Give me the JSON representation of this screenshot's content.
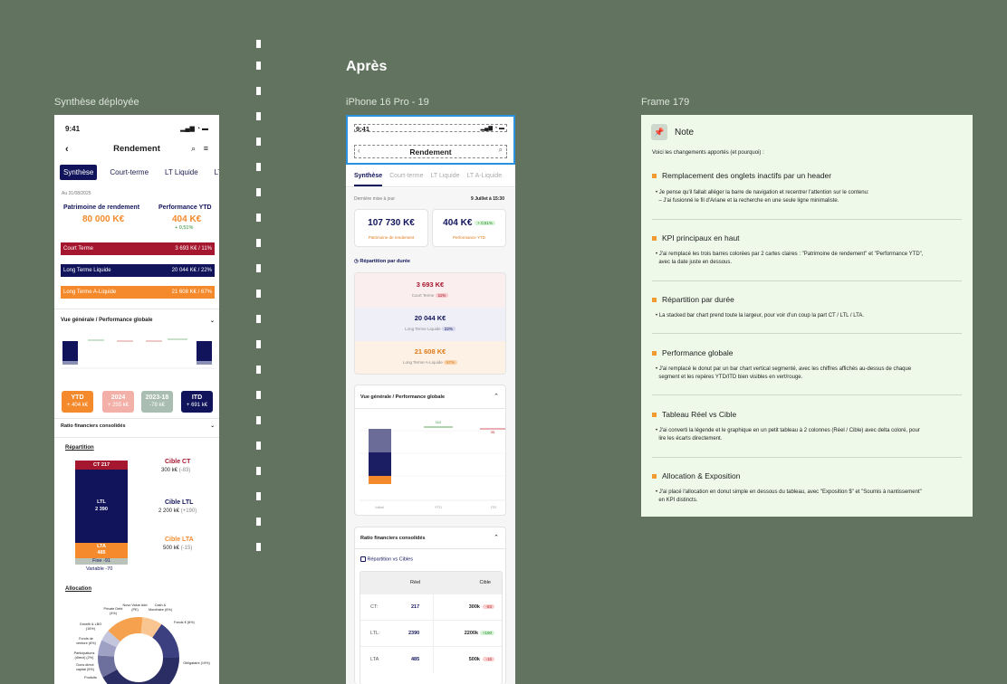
{
  "labels": {
    "left_frame": "Synthèse déployée",
    "after": "Après",
    "mid_frame": "iPhone 16 Pro - 19",
    "right_frame": "Frame 179"
  },
  "phone1": {
    "time": "9:41",
    "title": "Rendement",
    "tabs": [
      "Synthèse",
      "Court-terme",
      "LT Liquide",
      "LT"
    ],
    "date": "Au 31/08/2025",
    "kpi_left_label": "Patrimoine de rendement",
    "kpi_left_value": "80 000 K€",
    "kpi_right_label": "Performance YTD",
    "kpi_right_value": "404 K€",
    "kpi_right_delta": "+ 0,51%",
    "bars": [
      {
        "label": "Court Terme",
        "value": "3 693 K€  /  11%",
        "color": "#a5162f"
      },
      {
        "label": "Long Terme Liquide",
        "value": "20 044 K€  /  22%",
        "color": "#11145a"
      },
      {
        "label": "Long Terme A-Liquide",
        "value": "21 608 K€  /  67%",
        "color": "#f58a2c"
      }
    ],
    "section_overview": "Vue générale / Performance globale",
    "pills": [
      {
        "title": "YTD",
        "value": "+ 404 k€",
        "color": "#f58a2c"
      },
      {
        "title": "2024",
        "value": "+ 255 k€",
        "color": "#f3b0a8"
      },
      {
        "title": "2023-18",
        "value": "-78 k€",
        "color": "#a9bdb2"
      },
      {
        "title": "ITD",
        "value": "+ 691 k€",
        "color": "#11145a"
      }
    ],
    "section_ratios": "Ratio financiers consolidés",
    "repartition_title": "Répartition",
    "stack": {
      "ct": "CT 217",
      "ltl": "LTL",
      "ltl_val": "2 390",
      "lta": "LTA",
      "lta_val": "485",
      "fixe": "Fixe -91",
      "variable": "Variable -70"
    },
    "targets": [
      {
        "title": "Cible CT",
        "value": "300 k€",
        "delta": "(-83)",
        "color": "#a5162f"
      },
      {
        "title": "Cible LTL",
        "value": "2 200 k€",
        "delta": "(+190)",
        "color": "#11145a"
      },
      {
        "title": "Cible LTA",
        "value": "500 k€",
        "delta": "(-15)",
        "color": "#f58a2c"
      }
    ],
    "allocation_title": "Allocation",
    "donut_labels": {
      "a": "Private Debt (4%)",
      "b": "Novo Value Add (PE)",
      "c": "Cash & Monétaire (6%)",
      "d": "Fonds € (6%)",
      "e": "Growth & LBO (16%)",
      "f": "Fonds de venture (6%)",
      "g": "Participations (direct) (2%)",
      "h": "Dons direct capital (5%)",
      "i": "Obligataire (19%)",
      "j": "Produits"
    }
  },
  "phone2": {
    "time": "9:41",
    "title": "Rendement",
    "tabs": [
      "Synthèse",
      "Court-terme",
      "LT Liquide",
      "LT A-Liquide"
    ],
    "updated_label": "Dernière mise à jour",
    "updated_value": "9 Juillet à 15:30",
    "kpi1_value": "107 730 K€",
    "kpi1_label": "Patrimoine de rendement",
    "kpi2_value": "404 K€",
    "kpi2_tag": "+ 0,51%",
    "kpi2_label": "Performance YTD",
    "duration_title": "Répartition par durée",
    "durations": [
      {
        "value": "3 693 K€",
        "label": "Court Terme",
        "tag": "11%",
        "bg": "#fbeeee",
        "fg": "#a5162f",
        "tagbg": "#f6c9cc"
      },
      {
        "value": "20 044 K€",
        "label": "Long Terme Liquide",
        "tag": "22%",
        "bg": "#eff0f7",
        "fg": "#11145a",
        "tagbg": "#d3d5ea"
      },
      {
        "value": "21 608 K€",
        "label": "Long Terme A-Liquide",
        "tag": "67%",
        "bg": "#fdf1e5",
        "fg": "#e07a1a",
        "tagbg": "#f8d3ad"
      }
    ],
    "overview_title": "Vue générale / Performance globale",
    "chart_top_label": "112",
    "chart_right_label": "35",
    "chart_x": [
      "Initial",
      "YTD",
      "ITD"
    ],
    "ratios_title": "Ratio financiers consolidés",
    "rvc_title": "Répartition vs Cibles",
    "table_head": [
      "",
      "Réel",
      "Cible"
    ],
    "table_rows": [
      {
        "name": "CT:",
        "real": "217",
        "target": "300k",
        "delta": "-83",
        "dbg": "#f8d0d0",
        "dfg": "#c0262f"
      },
      {
        "name": "LTL:",
        "real": "2390",
        "target": "2200k",
        "delta": "+190",
        "dbg": "#d6f3d6",
        "dfg": "#2a8a2a"
      },
      {
        "name": "LTA",
        "real": "485",
        "target": "500k",
        "delta": "-15",
        "dbg": "#f8d0d0",
        "dfg": "#c0262f"
      }
    ]
  },
  "note": {
    "title": "Note",
    "intro": "Voici les changements apportés (et pourquoi) :",
    "items": [
      {
        "h": "Remplacement des onglets inactifs par un header",
        "p1": "Je pense qu'il fallait alléger la barre de navigation et recentrer l'attention sur le contenu:",
        "p2": "– J'ai fusionné le fil d'Ariane et la recherche en une seule ligne minimaliste."
      },
      {
        "h": "KPI principaux en haut",
        "p1": "J'ai remplacé les trois barres colorées par 2 cartes claires : \"Patrimoine de rendement\" et \"Performance YTD\",",
        "p2": "avec la date juste en dessous."
      },
      {
        "h": "Répartition par durée",
        "p1": "La stacked bar chart prend toute la largeur, pour voir d'un coup la part CT / LTL / LTA.",
        "p2": ""
      },
      {
        "h": "Performance globale",
        "p1": "J'ai remplacé le donut par un bar chart vertical segmenté, avec les chiffres affichés au-dessus de chaque",
        "p2": "segment et les repères YTD/ITD bien visibles en vert/rouge."
      },
      {
        "h": "Tableau Réel vs Cible",
        "p1": "J'ai converti la légende et le graphique en un petit tableau à 2 colonnes (Réel / Cible) avec delta coloré, pour",
        "p2": "lire les écarts directement."
      },
      {
        "h": "Allocation & Exposition",
        "p1": "J'ai placé l'allocation en donut simple en dessous du tableau, avec \"Exposition $\" et \"Soumis à nantissement\"",
        "p2": "en KPI distincts."
      }
    ]
  },
  "colors": {
    "ct": "#a5162f",
    "ltl": "#11145a",
    "lta": "#f58a2c",
    "bg": "#627460"
  }
}
